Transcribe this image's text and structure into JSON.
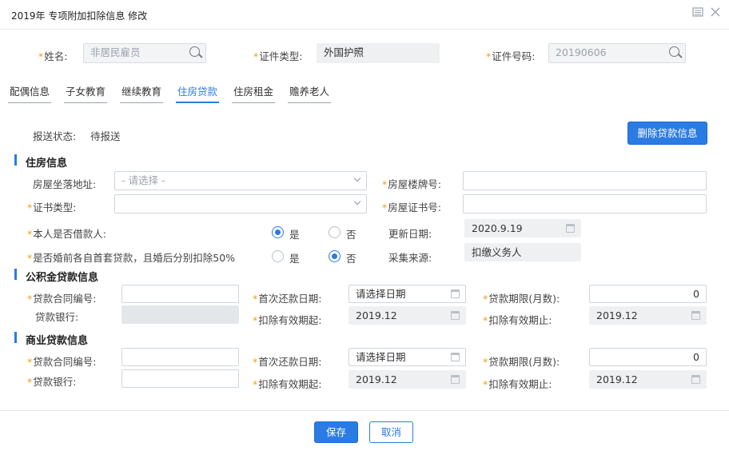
{
  "dialog": {
    "title": "2019年 专项附加扣除信息 修改",
    "icons": [
      "restore-icon",
      "close-icon"
    ]
  },
  "header": {
    "name_label": "姓名:",
    "name_value": "非居民雇员",
    "cert_type_label": "证件类型:",
    "cert_type_value": "外国护照",
    "cert_no_label": "证件号码:",
    "cert_no_value": "20190606"
  },
  "tabs": [
    "配偶信息",
    "子女教育",
    "继续教育",
    "住房贷款",
    "住房租金",
    "赡养老人"
  ],
  "active_tab": "住房贷款",
  "status": {
    "label": "报送状态:",
    "value": "待报送"
  },
  "delete_button": "删除贷款信息",
  "housing": {
    "title": "住房信息",
    "address_label": "房屋坐落地址:",
    "address_placeholder": "- 请选择 -",
    "house_no_label": "房屋楼牌号:",
    "cert_type_label": "证书类型:",
    "cert_no_label": "房屋证书号:",
    "borrower_label": "本人是否借款人:",
    "yes": "是",
    "no": "否",
    "update_date_label": "更新日期:",
    "update_date_value": "2020.9.19",
    "premarital_label": "是否婚前各自首套贷款，且婚后分别扣除50%",
    "source_label": "采集来源:",
    "source_value": "扣缴义务人",
    "borrower_selected": "yes",
    "premarital_selected": "no"
  },
  "provident": {
    "title": "公积金贷款信息",
    "contract_label": "贷款合同编号:",
    "first_pay_label": "首次还款日期:",
    "first_pay_value": "请选择日期",
    "term_label": "贷款期限(月数):",
    "term_value": "0",
    "bank_label": "贷款银行:",
    "start_label": "扣除有效期起:",
    "start_value": "2019.12",
    "end_label": "扣除有效期止:",
    "end_value": "2019.12"
  },
  "commercial": {
    "title": "商业贷款信息",
    "contract_label": "贷款合同编号:",
    "first_pay_label": "首次还款日期:",
    "first_pay_value": "请选择日期",
    "term_label": "贷款期限(月数):",
    "term_value": "0",
    "bank_label": "贷款银行:",
    "start_label": "扣除有效期起:",
    "start_value": "2019.12",
    "end_label": "扣除有效期止:",
    "end_value": "2019.12"
  },
  "footer": {
    "save": "保存",
    "cancel": "取消"
  },
  "colors": {
    "accent": "#2b7be4",
    "required": "#f39c12"
  }
}
